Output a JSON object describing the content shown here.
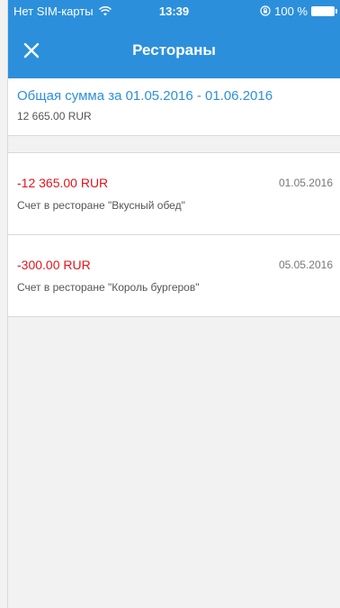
{
  "status_bar": {
    "carrier": "Нет SIM-карты",
    "time": "13:39",
    "battery": "100 %"
  },
  "nav": {
    "title": "Рестораны",
    "close_icon": "close-icon"
  },
  "summary": {
    "title": "Общая сумма за 01.05.2016 - 01.06.2016",
    "amount": "12 665.00 RUR"
  },
  "transactions": [
    {
      "amount": "-12 365.00 RUR",
      "date": "01.05.2016",
      "description": "Счет в ресторане \"Вкусный обед\""
    },
    {
      "amount": "-300.00 RUR",
      "date": "05.05.2016",
      "description": "Счет в ресторане \"Король бургеров\""
    }
  ],
  "colors": {
    "accent": "#2c8fdc",
    "negative": "#e4131a"
  }
}
